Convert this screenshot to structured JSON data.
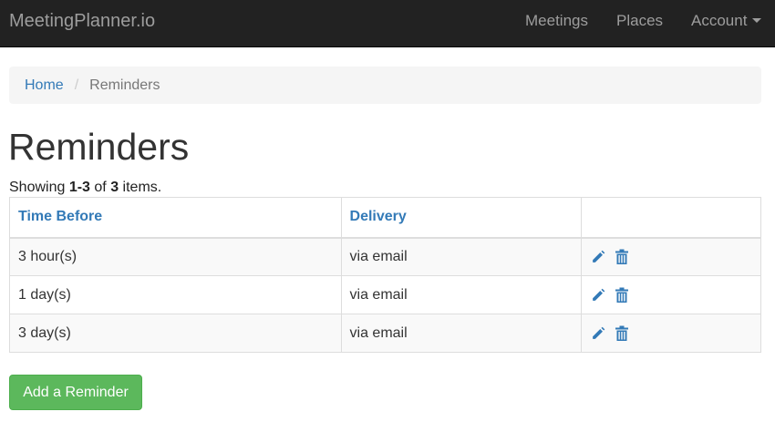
{
  "navbar": {
    "brand": "MeetingPlanner.io",
    "links": {
      "meetings": "Meetings",
      "places": "Places",
      "account": "Account"
    }
  },
  "breadcrumb": {
    "home": "Home",
    "separator": "/",
    "current": "Reminders"
  },
  "page": {
    "title": "Reminders"
  },
  "summary": {
    "prefix": "Showing ",
    "range": "1-3",
    "middle": " of ",
    "total": "3",
    "suffix": " items."
  },
  "table": {
    "headers": {
      "time_before": "Time Before",
      "delivery": "Delivery"
    },
    "rows": [
      {
        "time_before": "3 hour(s)",
        "delivery": "via email"
      },
      {
        "time_before": "1 day(s)",
        "delivery": "via email"
      },
      {
        "time_before": "3 day(s)",
        "delivery": "via email"
      }
    ],
    "row_actions": [
      "pencil-icon",
      "trash-icon"
    ]
  },
  "buttons": {
    "add_reminder": "Add a Reminder"
  },
  "colors": {
    "navbar_bg": "#222222",
    "link": "#337ab7",
    "success": "#5cb85c",
    "icon": "#337ab7"
  }
}
